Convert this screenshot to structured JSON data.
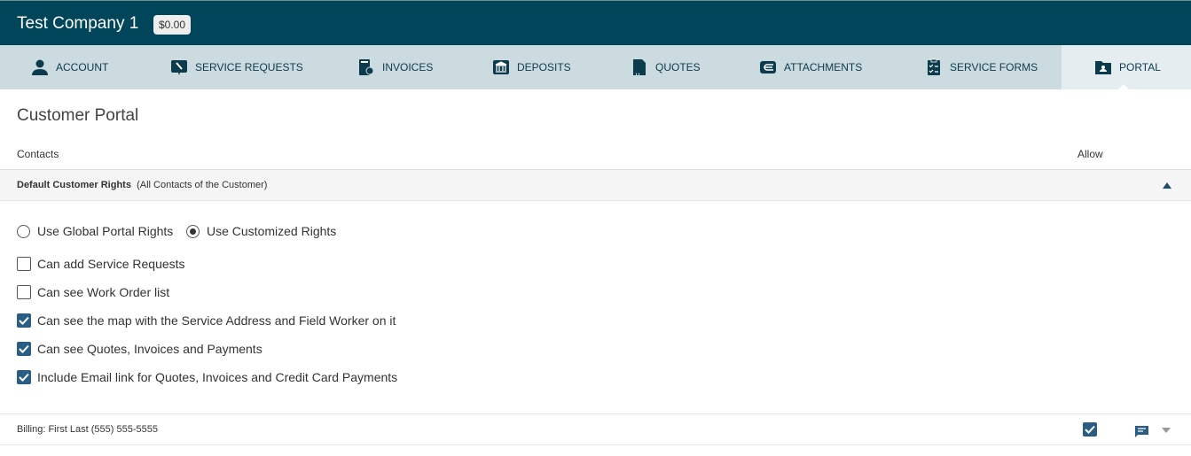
{
  "header": {
    "company": "Test Company 1",
    "balance": "$0.00"
  },
  "tabs": [
    {
      "label": "ACCOUNT",
      "icon": "person-icon"
    },
    {
      "label": "SERVICE REQUESTS",
      "icon": "wrench-icon"
    },
    {
      "label": "INVOICES",
      "icon": "invoice-icon"
    },
    {
      "label": "DEPOSITS",
      "icon": "bank-icon"
    },
    {
      "label": "QUOTES",
      "icon": "quote-icon"
    },
    {
      "label": "ATTACHMENTS",
      "icon": "attachment-icon"
    },
    {
      "label": "SERVICE FORMS",
      "icon": "clipboard-icon"
    },
    {
      "label": "PORTAL",
      "icon": "portal-folder-icon",
      "active": true
    }
  ],
  "page": {
    "title": "Customer Portal",
    "col_contacts": "Contacts",
    "col_allow": "Allow"
  },
  "section": {
    "title": "Default Customer Rights",
    "subtitle": "(All Contacts of the Customer)"
  },
  "radios": [
    {
      "label": "Use Global Portal Rights",
      "checked": false
    },
    {
      "label": "Use Customized Rights",
      "checked": true
    }
  ],
  "rights": [
    {
      "label": "Can add Service Requests",
      "checked": false
    },
    {
      "label": "Can see Work Order list",
      "checked": false
    },
    {
      "label": "Can see the map with the Service Address and Field Worker on it",
      "checked": true
    },
    {
      "label": "Can see Quotes, Invoices and Payments",
      "checked": true
    },
    {
      "label": "Include Email link for Quotes, Invoices and Credit Card Payments",
      "checked": true
    }
  ],
  "contacts": [
    {
      "label": "Billing: First Last (555) 555-5555",
      "allow": true
    }
  ],
  "colors": {
    "header": "#00455a",
    "tabbar": "#ccdbe0",
    "accent": "#2a5d84"
  }
}
